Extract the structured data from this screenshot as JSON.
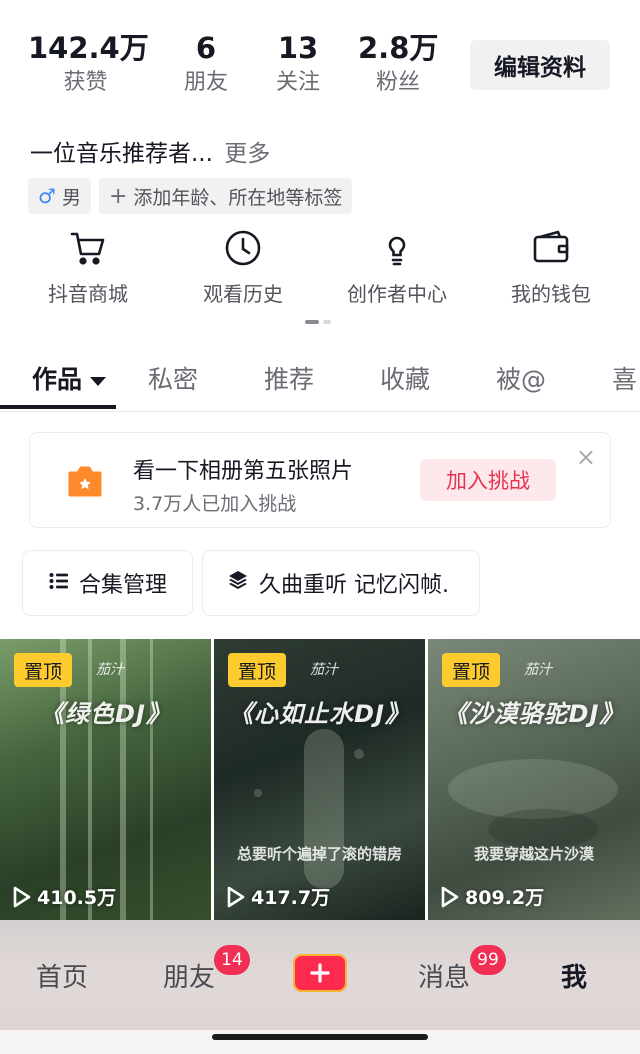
{
  "profile": {
    "stats": [
      {
        "value": "142.4万",
        "label": "获赞"
      },
      {
        "value": "6",
        "label": "朋友"
      },
      {
        "value": "13",
        "label": "关注"
      },
      {
        "value": "2.8万",
        "label": "粉丝"
      }
    ],
    "edit_button": "编辑资料",
    "bio": "一位音乐推荐者...",
    "bio_more": "更多",
    "tags": {
      "gender_symbol": "♂",
      "gender": "男",
      "add_symbol": "+",
      "add_tags": "添加年龄、所在地等标签"
    }
  },
  "tools": [
    {
      "label": "抖音商城",
      "icon": "cart-icon"
    },
    {
      "label": "观看历史",
      "icon": "clock-icon"
    },
    {
      "label": "创作者中心",
      "icon": "lightbulb-icon"
    },
    {
      "label": "我的钱包",
      "icon": "wallet-icon"
    }
  ],
  "tabs": {
    "items": [
      "作品",
      "私密",
      "推荐",
      "收藏",
      "被@",
      "喜"
    ],
    "active": "作品"
  },
  "challenge": {
    "title": "看一下相册第五张照片",
    "subtitle": "3.7万人已加入挑战",
    "button": "加入挑战",
    "close": "×"
  },
  "collections": [
    {
      "label": "合集管理",
      "icon": "list-icon"
    },
    {
      "label": "久曲重听 记忆闪帧.",
      "icon": "layers-icon"
    }
  ],
  "videos": [
    {
      "pinned": "置顶",
      "brand": "茄汁",
      "title": "《绿色DJ》",
      "subtitle": "",
      "plays": "410.5万"
    },
    {
      "pinned": "置顶",
      "brand": "茄汁",
      "title": "《心如止水DJ》",
      "subtitle": "总要听个遍掉了滚的错房",
      "plays": "417.7万"
    },
    {
      "pinned": "置顶",
      "brand": "茄汁",
      "title": "《沙漠骆驼DJ》",
      "subtitle": "我要穿越这片沙漠",
      "plays": "809.2万"
    }
  ],
  "bottom_nav": {
    "home": "首页",
    "friends": "朋友",
    "friends_badge": "14",
    "add": "+",
    "messages": "消息",
    "messages_badge": "99",
    "me": "我"
  },
  "colors": {
    "accent": "#fe2c55",
    "pin_yellow": "#fecb2f",
    "gender_blue": "#3d8af5"
  }
}
